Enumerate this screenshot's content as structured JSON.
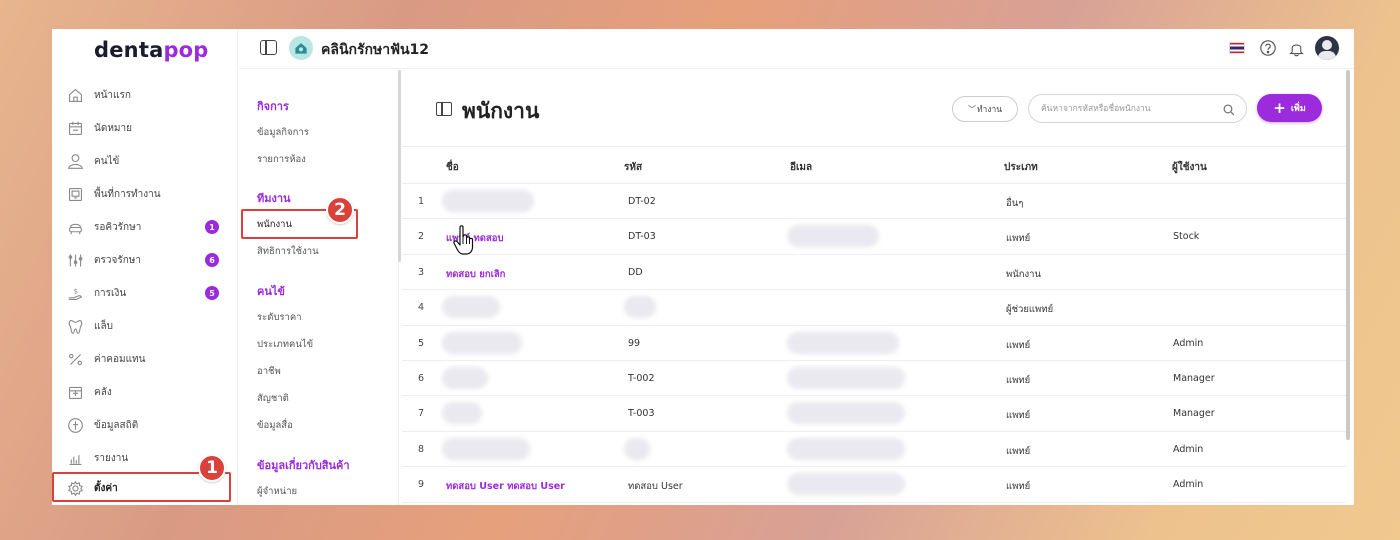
{
  "brand": {
    "logo_part1": "denta",
    "logo_part2": "pop"
  },
  "topbar": {
    "clinic_name": "คลินิกรักษาฟัน12"
  },
  "sidebar": {
    "items": [
      {
        "label": "หน้าแรก",
        "icon": "home-icon"
      },
      {
        "label": "นัดหมาย",
        "icon": "calendar-icon"
      },
      {
        "label": "คนไข้",
        "icon": "user-icon"
      },
      {
        "label": "พื้นที่การทำงาน",
        "icon": "workspace-icon"
      },
      {
        "label": "รอคิวรักษา",
        "icon": "dental-chair-icon",
        "badge": "1"
      },
      {
        "label": "ตรวจรักษา",
        "icon": "tools-icon",
        "badge": "6"
      },
      {
        "label": "การเงิน",
        "icon": "money-hand-icon",
        "badge": "5"
      },
      {
        "label": "แล็บ",
        "icon": "tooth-icon"
      },
      {
        "label": "ค่าคอมแทน",
        "icon": "percent-icon"
      },
      {
        "label": "คลัง",
        "icon": "box-icon"
      },
      {
        "label": "ข้อมูลสถิติ",
        "icon": "stats-icon"
      },
      {
        "label": "รายงาน",
        "icon": "report-chart-icon"
      },
      {
        "label": "ตั้งค่า",
        "icon": "gear-icon"
      }
    ]
  },
  "steps": {
    "one": "1",
    "two": "2"
  },
  "subnav": {
    "section1": {
      "title": "กิจการ",
      "items": [
        "ข้อมูลกิจการ",
        "รายการห้อง"
      ]
    },
    "section2": {
      "title": "ทีมงาน",
      "items": [
        "พนักงาน",
        "สิทธิการใช้งาน"
      ]
    },
    "section3": {
      "title": "คนไข้",
      "items": [
        "ระดับราคา",
        "ประเภทคนไข้",
        "อาชีพ",
        "สัญชาติ",
        "ข้อมูลสื่อ"
      ]
    },
    "section4": {
      "title": "ข้อมูลเกี่ยวกับสินค้า",
      "items": [
        "ผู้จำหน่าย"
      ]
    }
  },
  "main": {
    "title": "พนักงาน",
    "filter_label": "ทำงาน",
    "search_placeholder": "ค้นหาจากรหัสหรือชื่อพนักงาน",
    "add_label": "เพิ่ม",
    "columns": {
      "name": "ชื่อ",
      "code": "รหัส",
      "email": "อีเมล",
      "type": "ประเภท",
      "user": "ผู้ใช้งาน"
    },
    "rows": [
      {
        "num": "1",
        "name": "",
        "code": "DT-02",
        "type": "อื่นๆ",
        "user": ""
      },
      {
        "num": "2",
        "name": "แพทย์ ทดสอบ",
        "code": "DT-03",
        "type": "แพทย์",
        "user": "Stock"
      },
      {
        "num": "3",
        "name": "ทดสอบ ยกเลิก",
        "code": "DD",
        "type": "พนักงาน",
        "user": ""
      },
      {
        "num": "4",
        "name": "",
        "code": "",
        "type": "ผู้ช่วยแพทย์",
        "user": ""
      },
      {
        "num": "5",
        "name": "",
        "code": "99",
        "type": "แพทย์",
        "user": "Admin"
      },
      {
        "num": "6",
        "name": "",
        "code": "T-002",
        "type": "แพทย์",
        "user": "Manager"
      },
      {
        "num": "7",
        "name": "",
        "code": "T-003",
        "type": "แพทย์",
        "user": "Manager"
      },
      {
        "num": "8",
        "name": "",
        "code": "",
        "type": "แพทย์",
        "user": "Admin"
      },
      {
        "num": "9",
        "name": "ทดสอบ User ทดสอบ User",
        "code": "ทดสอบ User",
        "type": "แพทย์",
        "user": "Admin"
      }
    ]
  },
  "colors": {
    "accent": "#9b2bdc",
    "highlight": "#d9413a"
  }
}
